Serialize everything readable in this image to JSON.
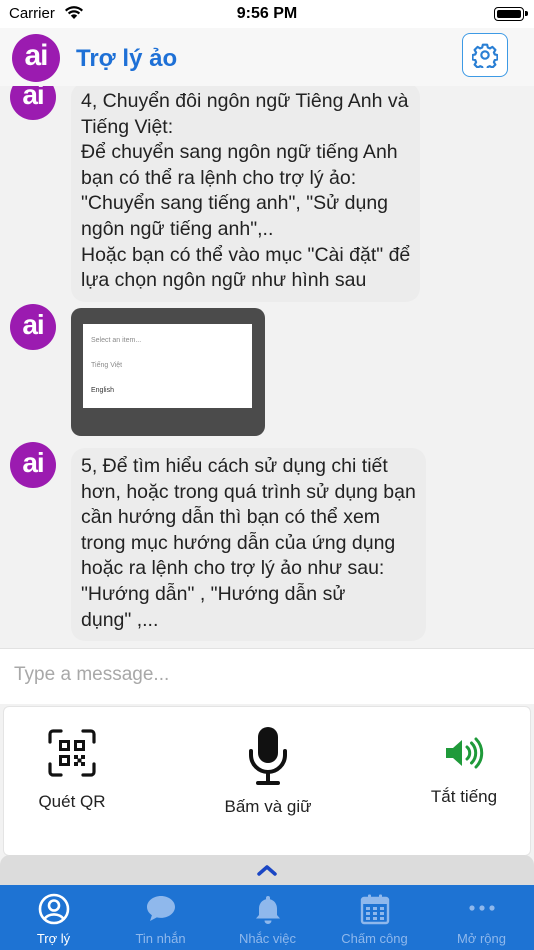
{
  "status_bar": {
    "carrier": "Carrier",
    "time": "9:56 PM"
  },
  "header": {
    "title": "Trợ lý ảo",
    "logo_text": "ai"
  },
  "messages": [
    {
      "lines": [
        "4, Chuyển đôi ngôn ngữ Tiêng Anh và",
        "Tiếng Việt:",
        "Để chuyển sang ngôn ngữ tiếng Anh",
        "bạn có thể ra lệnh cho trợ lý ảo:",
        "\"Chuyển sang tiếng anh\", \"Sử dụng",
        "ngôn ngữ tiếng anh\",..",
        "Hoặc bạn có thể vào mục \"Cài đặt\" để",
        "lựa chọn ngôn ngữ như hình sau"
      ]
    },
    {
      "image_lines": [
        "Select an item...",
        "Tiếng Việt",
        "English"
      ]
    },
    {
      "lines": [
        "5, Để tìm hiểu cách sử dụng chi tiết",
        "hơn, hoặc trong quá trình sử dụng bạn",
        "cần hướng dẫn thì bạn có thể xem",
        "trong mục hướng dẫn của ứng dụng",
        "hoặc ra lệnh cho trợ lý ảo như sau:",
        "\"Hướng dẫn\" , \"Hướng dẫn sử",
        "dụng\" ,..."
      ]
    }
  ],
  "input": {
    "placeholder": "Type a message..."
  },
  "actions": {
    "scan_qr": "Quét QR",
    "hold_to_talk": "Bấm và giữ",
    "mute": "Tắt tiếng"
  },
  "tabs": [
    {
      "label": "Trợ lý",
      "icon": "user-icon",
      "active": true
    },
    {
      "label": "Tin nhắn",
      "icon": "chat-bubble-icon"
    },
    {
      "label": "Nhắc việc",
      "icon": "bell-icon"
    },
    {
      "label": "Chấm công",
      "icon": "calendar-icon"
    },
    {
      "label": "Mở rộng",
      "icon": "more-icon"
    }
  ],
  "colors": {
    "brand_purple": "#9b1bb0",
    "title_blue": "#1e70d6",
    "tab_bar": "#1e73d3",
    "mute_green": "#1f9a3a"
  }
}
